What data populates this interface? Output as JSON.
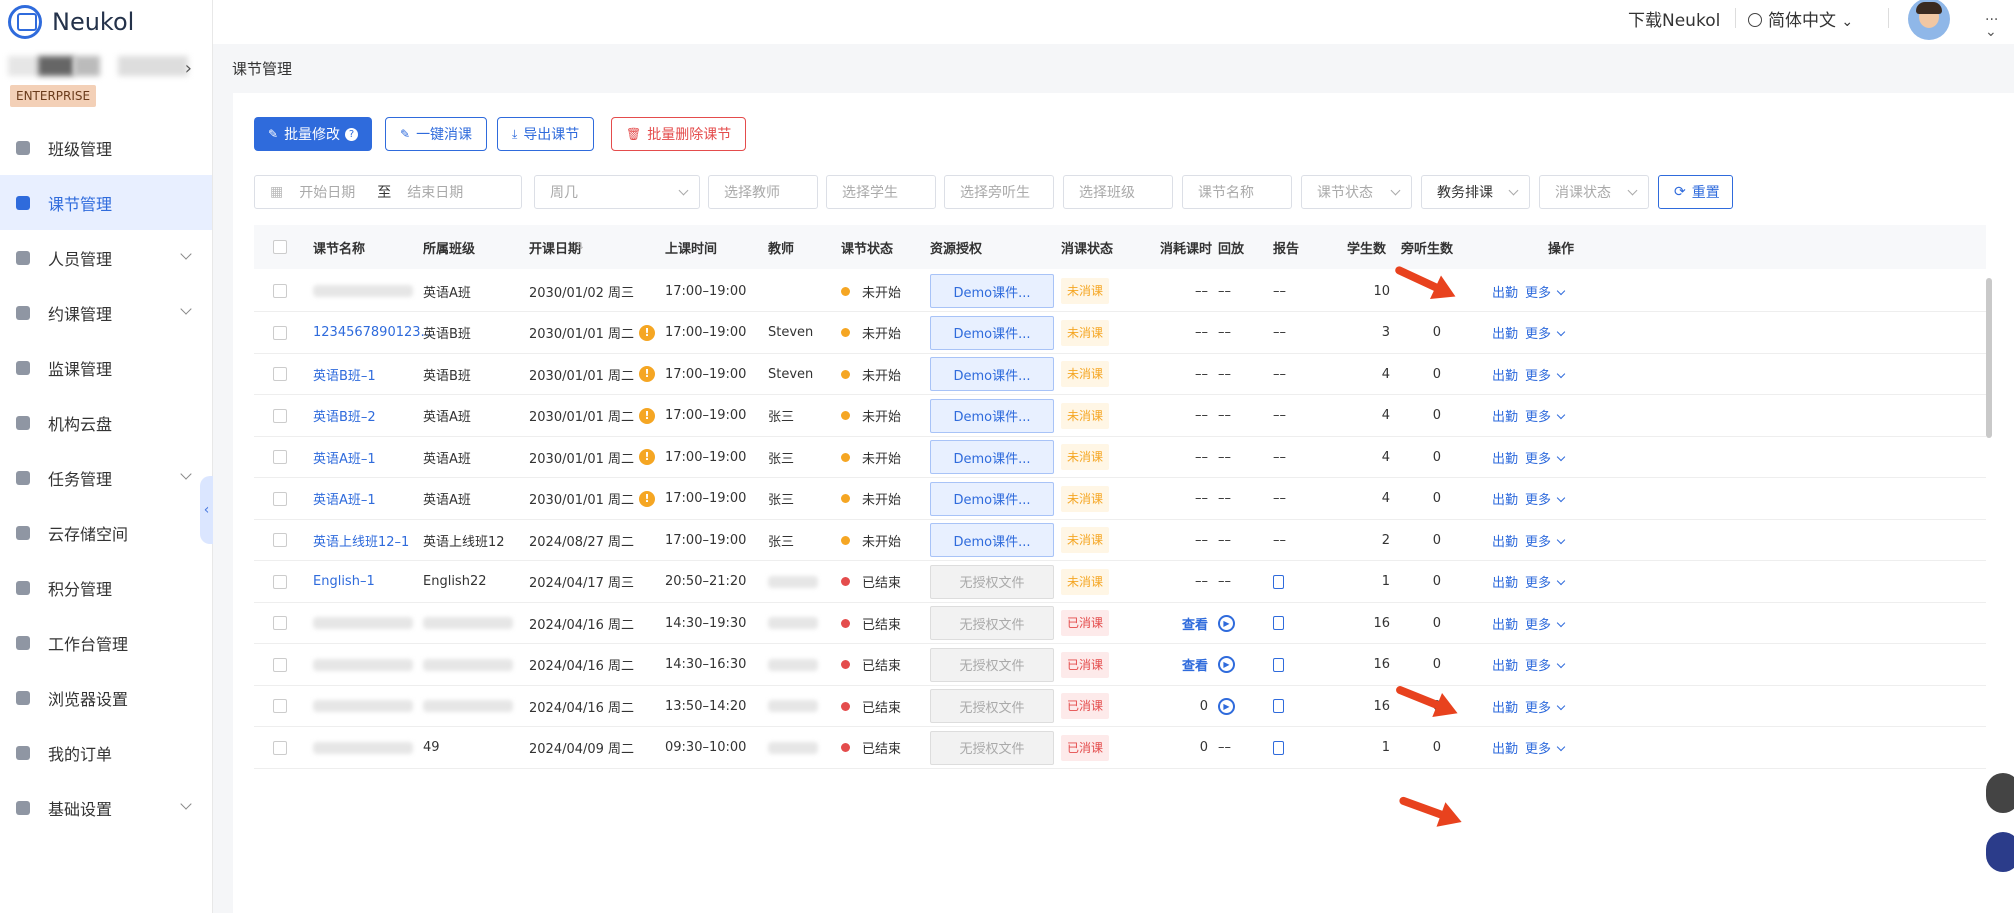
{
  "app": {
    "name": "Neukol",
    "plan": "ENTERPRISE"
  },
  "topbar": {
    "download": "下载Neukol",
    "language": "简体中文",
    "user": "..."
  },
  "breadcrumb": "课节管理",
  "sidebar": [
    {
      "label": "班级管理",
      "icon": "class-icon",
      "expand": false
    },
    {
      "label": "课节管理",
      "icon": "lesson-list-icon",
      "expand": false,
      "active": true
    },
    {
      "label": "人员管理",
      "icon": "people-icon",
      "expand": true
    },
    {
      "label": "约课管理",
      "icon": "booking-icon",
      "expand": true
    },
    {
      "label": "监课管理",
      "icon": "monitor-icon",
      "expand": false
    },
    {
      "label": "机构云盘",
      "icon": "cloud-disk-icon",
      "expand": false
    },
    {
      "label": "任务管理",
      "icon": "task-icon",
      "expand": true
    },
    {
      "label": "云存储空间",
      "icon": "storage-icon",
      "expand": false
    },
    {
      "label": "积分管理",
      "icon": "points-icon",
      "expand": false
    },
    {
      "label": "工作台管理",
      "icon": "workbench-icon",
      "expand": false
    },
    {
      "label": "浏览器设置",
      "icon": "browser-icon",
      "expand": false
    },
    {
      "label": "我的订单",
      "icon": "order-icon",
      "expand": false
    },
    {
      "label": "基础设置",
      "icon": "settings-icon",
      "expand": true
    }
  ],
  "toolbar": {
    "batch_edit": "批量修改",
    "one_click": "一键消课",
    "export": "导出课节",
    "batch_delete": "批量删除课节"
  },
  "filters": {
    "start_date": "开始日期",
    "to": "至",
    "end_date": "结束日期",
    "weekday": "周几",
    "teacher": "选择教师",
    "student": "选择学生",
    "auditor": "选择旁听生",
    "class": "选择班级",
    "lesson_name": "课节名称",
    "lesson_status": "课节状态",
    "schedule": "教务排课",
    "consume_status": "消课状态",
    "reset": "重置"
  },
  "columns": [
    "课节名称",
    "所属班级",
    "开课日期",
    "上课时间",
    "教师",
    "课节状态",
    "资源授权",
    "消课状态",
    "消耗课时",
    "回放",
    "报告",
    "学生数",
    "旁听生数",
    "操作"
  ],
  "actions": {
    "attend": "出勤",
    "more": "更多"
  },
  "rows": [
    {
      "name": "",
      "class": "英语A班",
      "date": "2030/01/02 周三",
      "time": "17:00–19:00",
      "teacher": "",
      "status": "未开始",
      "status_color": "#f5a623",
      "res": "Demo课件...",
      "res_type": "demo",
      "consume": "未消课",
      "consume_type": "y",
      "hours": "––",
      "hours_link": false,
      "playback": "––",
      "report": "––",
      "students": "10",
      "auditors": "2",
      "warn": false
    },
    {
      "name": "1234567890123...",
      "class": "英语B班",
      "date": "2030/01/01 周二",
      "time": "17:00–19:00",
      "teacher": "Steven",
      "status": "未开始",
      "status_color": "#f5a623",
      "res": "Demo课件...",
      "res_type": "demo",
      "consume": "未消课",
      "consume_type": "y",
      "hours": "––",
      "hours_link": false,
      "playback": "––",
      "report": "––",
      "students": "3",
      "auditors": "0",
      "warn": true
    },
    {
      "name": "英语B班–1",
      "class": "英语B班",
      "date": "2030/01/01 周二",
      "time": "17:00–19:00",
      "teacher": "Steven",
      "status": "未开始",
      "status_color": "#f5a623",
      "res": "Demo课件...",
      "res_type": "demo",
      "consume": "未消课",
      "consume_type": "y",
      "hours": "––",
      "hours_link": false,
      "playback": "––",
      "report": "––",
      "students": "4",
      "auditors": "0",
      "warn": true
    },
    {
      "name": "英语B班–2",
      "class": "英语A班",
      "date": "2030/01/01 周二",
      "time": "17:00–19:00",
      "teacher": "张三",
      "status": "未开始",
      "status_color": "#f5a623",
      "res": "Demo课件...",
      "res_type": "demo",
      "consume": "未消课",
      "consume_type": "y",
      "hours": "––",
      "hours_link": false,
      "playback": "––",
      "report": "––",
      "students": "4",
      "auditors": "0",
      "warn": true
    },
    {
      "name": "英语A班–1",
      "class": "英语A班",
      "date": "2030/01/01 周二",
      "time": "17:00–19:00",
      "teacher": "张三",
      "status": "未开始",
      "status_color": "#f5a623",
      "res": "Demo课件...",
      "res_type": "demo",
      "consume": "未消课",
      "consume_type": "y",
      "hours": "––",
      "hours_link": false,
      "playback": "––",
      "report": "––",
      "students": "4",
      "auditors": "0",
      "warn": true
    },
    {
      "name": "英语A班–1",
      "class": "英语A班",
      "date": "2030/01/01 周二",
      "time": "17:00–19:00",
      "teacher": "张三",
      "status": "未开始",
      "status_color": "#f5a623",
      "res": "Demo课件...",
      "res_type": "demo",
      "consume": "未消课",
      "consume_type": "y",
      "hours": "––",
      "hours_link": false,
      "playback": "––",
      "report": "––",
      "students": "4",
      "auditors": "0",
      "warn": true
    },
    {
      "name": "英语上线班12–1",
      "class": "英语上线班12",
      "date": "2024/08/27 周二",
      "time": "17:00–19:00",
      "teacher": "张三",
      "status": "未开始",
      "status_color": "#f5a623",
      "res": "Demo课件...",
      "res_type": "demo",
      "consume": "未消课",
      "consume_type": "y",
      "hours": "––",
      "hours_link": false,
      "playback": "––",
      "report": "––",
      "students": "2",
      "auditors": "0",
      "warn": false
    },
    {
      "name": "English–1",
      "class": "English22",
      "date": "2024/04/17 周三",
      "time": "20:50–21:20",
      "teacher": "",
      "status": "已结束",
      "status_color": "#e44c4c",
      "res": "无授权文件",
      "res_type": "none",
      "consume": "未消课",
      "consume_type": "y",
      "hours": "––",
      "hours_link": false,
      "playback": "––",
      "report": "icon",
      "students": "1",
      "auditors": "0",
      "warn": false
    },
    {
      "name": "",
      "class": "",
      "date": "2024/04/16 周二",
      "time": "14:30–19:30",
      "teacher": "",
      "status": "已结束",
      "status_color": "#e44c4c",
      "res": "无授权文件",
      "res_type": "none",
      "consume": "已消课",
      "consume_type": "r",
      "hours": "查看",
      "hours_link": true,
      "playback": "icon",
      "report": "icon",
      "students": "16",
      "auditors": "0",
      "warn": false
    },
    {
      "name": "",
      "class": "",
      "date": "2024/04/16 周二",
      "time": "14:30–16:30",
      "teacher": "",
      "status": "已结束",
      "status_color": "#e44c4c",
      "res": "无授权文件",
      "res_type": "none",
      "consume": "已消课",
      "consume_type": "r",
      "hours": "查看",
      "hours_link": true,
      "playback": "icon",
      "report": "icon",
      "students": "16",
      "auditors": "0",
      "warn": false
    },
    {
      "name": "",
      "class": "",
      "date": "2024/04/16 周二",
      "time": "13:50–14:20",
      "teacher": "",
      "status": "已结束",
      "status_color": "#e44c4c",
      "res": "无授权文件",
      "res_type": "none",
      "consume": "已消课",
      "consume_type": "r",
      "hours": "0",
      "hours_link": false,
      "playback": "icon",
      "report": "icon",
      "students": "16",
      "auditors": "0",
      "warn": false
    },
    {
      "name": "",
      "class": "49",
      "date": "2024/04/09 周二",
      "time": "09:30–10:00",
      "teacher": "",
      "status": "已结束",
      "status_color": "#e44c4c",
      "res": "无授权文件",
      "res_type": "none",
      "consume": "已消课",
      "consume_type": "r",
      "hours": "0",
      "hours_link": false,
      "playback": "––",
      "report": "icon",
      "students": "1",
      "auditors": "0",
      "warn": false
    }
  ]
}
